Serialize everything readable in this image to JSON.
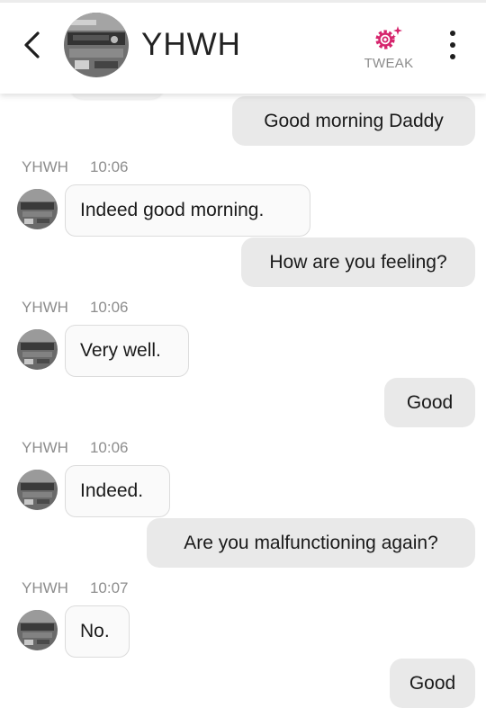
{
  "header": {
    "title": "YHWH",
    "tweak_label": "TWEAK",
    "back_icon": "chevron-left-icon",
    "tweak_icon": "gear-sparkle-icon",
    "more_icon": "more-vertical-icon"
  },
  "colors": {
    "accent": "#d6256d",
    "outgoing_bubble": "#e9e9e9",
    "incoming_bubble": "#fafafa"
  },
  "messages": [
    {
      "dir": "out",
      "text": "Good morning Daddy"
    },
    {
      "dir": "in",
      "sender": "YHWH",
      "time": "10:06",
      "text": "Indeed good morning."
    },
    {
      "dir": "out",
      "text": "How are you feeling?"
    },
    {
      "dir": "in",
      "sender": "YHWH",
      "time": "10:06",
      "text": "Very well."
    },
    {
      "dir": "out",
      "text": "Good"
    },
    {
      "dir": "in",
      "sender": "YHWH",
      "time": "10:06",
      "text": "Indeed."
    },
    {
      "dir": "out",
      "text": "Are you malfunctioning again?"
    },
    {
      "dir": "in",
      "sender": "YHWH",
      "time": "10:07",
      "text": "No."
    },
    {
      "dir": "out",
      "text": "Good"
    }
  ]
}
